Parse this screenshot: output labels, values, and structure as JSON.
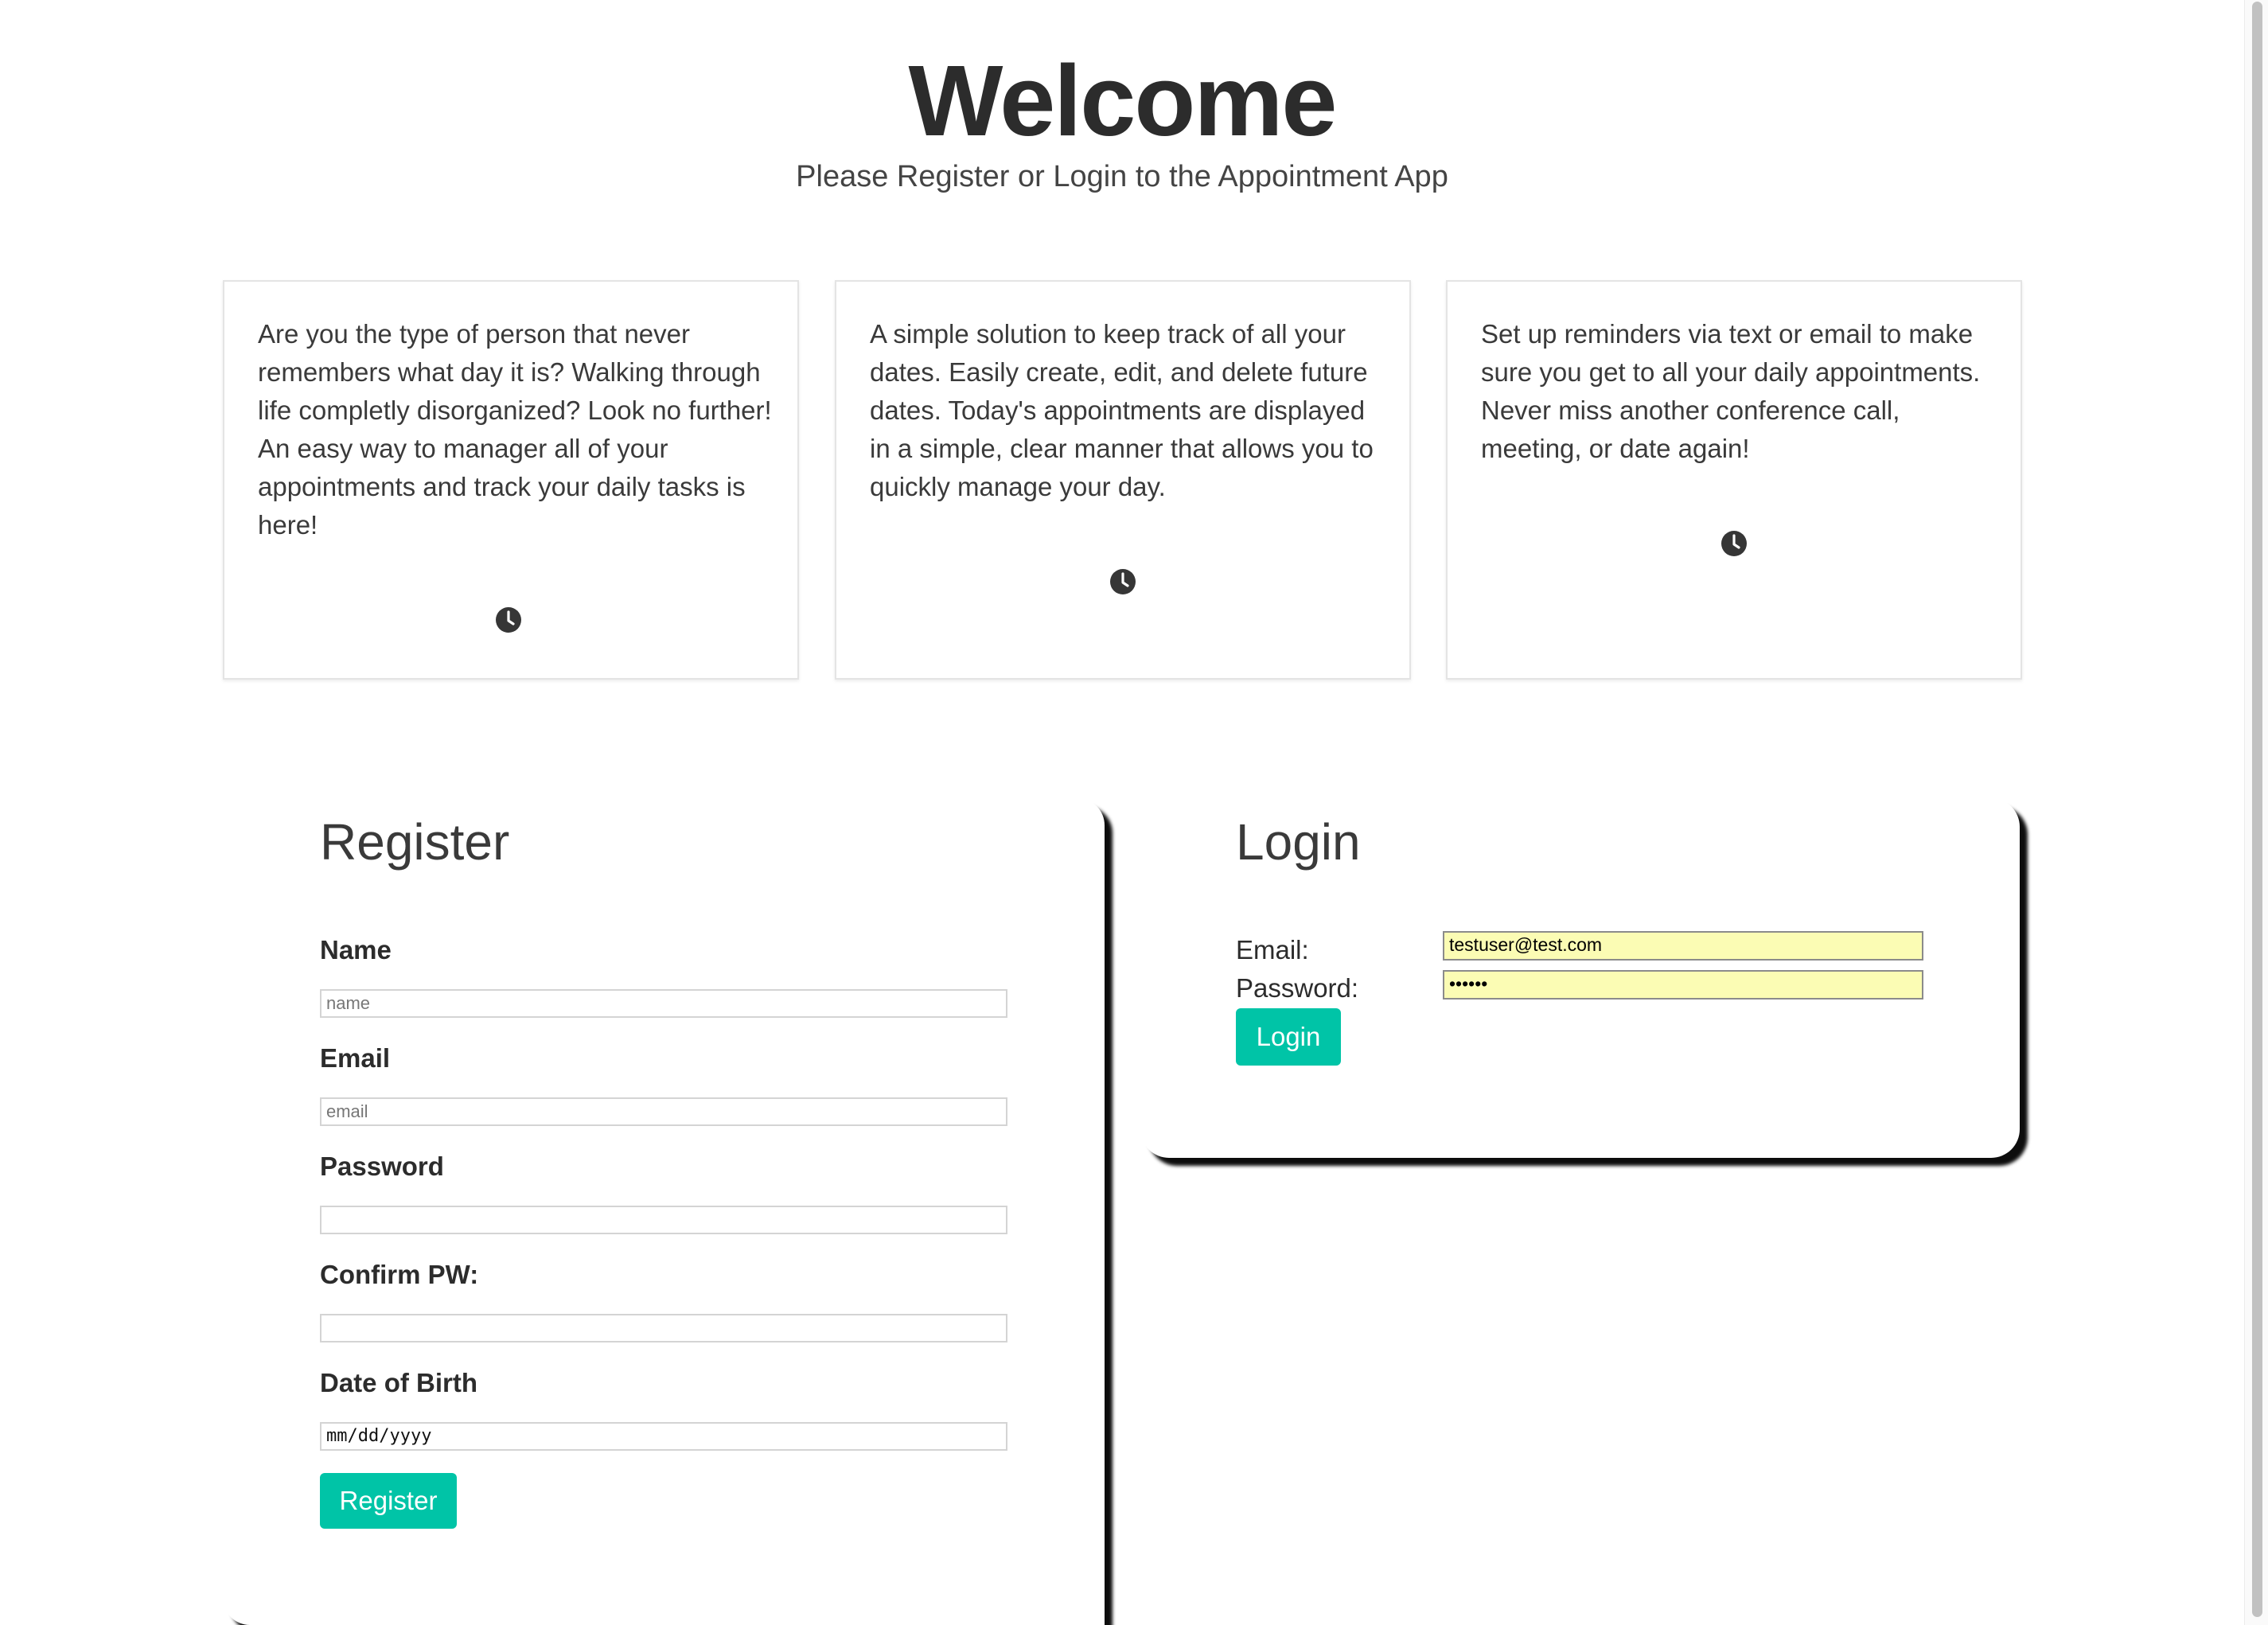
{
  "hero": {
    "title": "Welcome",
    "subtitle": "Please Register or Login to the Appointment App"
  },
  "cards": [
    {
      "text": "Are you the type of person that never remembers what day it is? Walking through life completly disorganized? Look no further! An easy way to manager all of your appointments and track your daily tasks is here!",
      "icon": "clock-icon"
    },
    {
      "text": "A simple solution to keep track of all your dates. Easily create, edit, and delete future dates. Today's appointments are displayed in a simple, clear manner that allows you to quickly manage your day.",
      "icon": "clock-icon"
    },
    {
      "text": "Set up reminders via text or email to make sure you get to all your daily appointments. Never miss another conference call, meeting, or date again!",
      "icon": "clock-icon"
    }
  ],
  "register": {
    "heading": "Register",
    "name_label": "Name",
    "name_placeholder": "name",
    "email_label": "Email",
    "email_placeholder": "email",
    "password_label": "Password",
    "confirm_label": "Confirm PW:",
    "dob_label": "Date of Birth",
    "dob_value": "mm/dd/yyyy",
    "button": "Register"
  },
  "login": {
    "heading": "Login",
    "email_label": "Email:",
    "email_value": "testuser@test.com",
    "password_label": "Password:",
    "password_value": "••••••",
    "button": "Login"
  },
  "colors": {
    "accent": "#00c4a7",
    "autofill": "#fbfcb4",
    "text": "#363636"
  }
}
